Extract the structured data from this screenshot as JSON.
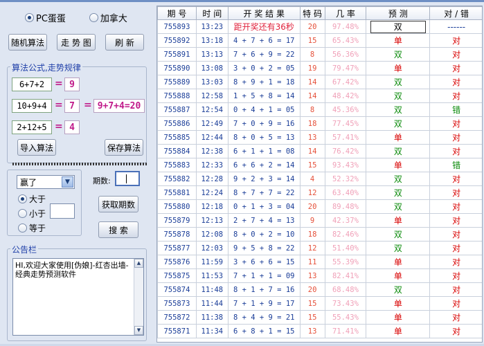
{
  "mode": {
    "option1": "PC蛋蛋",
    "option2": "加拿大",
    "selected": 1
  },
  "buttons": {
    "random": "随机算法",
    "trend": "走 势 图",
    "refresh": "刷 新",
    "import": "导入算法",
    "save": "保存算法",
    "getPeriods": "获取期数",
    "search": "搜 索"
  },
  "formula": {
    "title": "算法公式,走势规律",
    "rows": [
      {
        "expr": "6+7+2",
        "eq": "=",
        "val": "9"
      },
      {
        "expr": "10+9+4",
        "eq": "=",
        "val": "7"
      },
      {
        "expr": "2+12+5",
        "eq": "=",
        "val": "4"
      }
    ],
    "combined_eq": "=",
    "combined": "9+7+4=20"
  },
  "divider": "=================================",
  "filter": {
    "select_value": "赢了",
    "periods_label": "期数:",
    "periods_value": "",
    "opt_gt": "大于",
    "opt_lt": "小于",
    "opt_eq": "等于",
    "lt_value": ""
  },
  "notice": {
    "title": "公告栏",
    "text": "HI,欢迎大家使用[伪娘]-红杏出墙-经典走势预测软件"
  },
  "table": {
    "headers": [
      "期 号",
      "时 间",
      "开 奖 结 果",
      "特 码",
      "几 率",
      "预 测",
      "对 / 错"
    ],
    "rows": [
      [
        "755893",
        "13:23",
        "距开奖还有36秒",
        "20",
        "97.48%",
        "双",
        "------"
      ],
      [
        "755892",
        "13:18",
        "4 + 7 + 6 = 17",
        "15",
        "65.43%",
        "单",
        "对"
      ],
      [
        "755891",
        "13:13",
        "7 + 6 + 9 = 22",
        "8",
        "56.36%",
        "双",
        "对"
      ],
      [
        "755890",
        "13:08",
        "3 + 0 + 2 = 05",
        "19",
        "79.47%",
        "单",
        "对"
      ],
      [
        "755889",
        "13:03",
        "8 + 9 + 1 = 18",
        "14",
        "67.42%",
        "双",
        "对"
      ],
      [
        "755888",
        "12:58",
        "1 + 5 + 8 = 14",
        "14",
        "48.42%",
        "双",
        "对"
      ],
      [
        "755887",
        "12:54",
        "0 + 4 + 1 = 05",
        "8",
        "45.36%",
        "双",
        "错"
      ],
      [
        "755886",
        "12:49",
        "7 + 0 + 9 = 16",
        "18",
        "77.45%",
        "双",
        "对"
      ],
      [
        "755885",
        "12:44",
        "8 + 0 + 5 = 13",
        "13",
        "57.41%",
        "单",
        "对"
      ],
      [
        "755884",
        "12:38",
        "6 + 1 + 1 = 08",
        "14",
        "76.42%",
        "双",
        "对"
      ],
      [
        "755883",
        "12:33",
        "6 + 6 + 2 = 14",
        "15",
        "93.43%",
        "单",
        "错"
      ],
      [
        "755882",
        "12:28",
        "9 + 2 + 3 = 14",
        "4",
        "52.32%",
        "双",
        "对"
      ],
      [
        "755881",
        "12:24",
        "8 + 7 + 7 = 22",
        "12",
        "63.40%",
        "双",
        "对"
      ],
      [
        "755880",
        "12:18",
        "0 + 1 + 3 = 04",
        "20",
        "89.48%",
        "双",
        "对"
      ],
      [
        "755879",
        "12:13",
        "2 + 7 + 4 = 13",
        "9",
        "42.37%",
        "单",
        "对"
      ],
      [
        "755878",
        "12:08",
        "8 + 0 + 2 = 10",
        "18",
        "82.46%",
        "双",
        "对"
      ],
      [
        "755877",
        "12:03",
        "9 + 5 + 8 = 22",
        "12",
        "51.40%",
        "双",
        "对"
      ],
      [
        "755876",
        "11:59",
        "3 + 6 + 6 = 15",
        "11",
        "55.39%",
        "单",
        "对"
      ],
      [
        "755875",
        "11:53",
        "7 + 1 + 1 = 09",
        "13",
        "82.41%",
        "单",
        "对"
      ],
      [
        "755874",
        "11:48",
        "8 + 1 + 7 = 16",
        "20",
        "68.48%",
        "双",
        "对"
      ],
      [
        "755873",
        "11:44",
        "7 + 1 + 9 = 17",
        "15",
        "73.43%",
        "单",
        "对"
      ],
      [
        "755872",
        "11:38",
        "8 + 4 + 9 = 21",
        "15",
        "55.43%",
        "单",
        "对"
      ],
      [
        "755871",
        "11:34",
        "6 + 8 + 1 = 15",
        "13",
        "71.41%",
        "单",
        "对"
      ]
    ]
  },
  "colors": {
    "red": "#d80000",
    "green": "#0a8a0a",
    "blue": "#1a3d98",
    "magenta": "#c01a8a"
  }
}
